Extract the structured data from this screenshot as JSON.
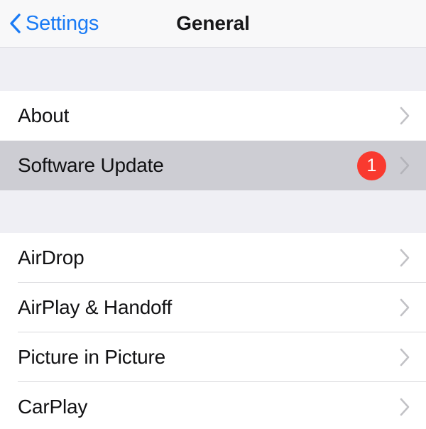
{
  "navbar": {
    "back_label": "Settings",
    "back_icon": "chevron-left-icon",
    "title": "General",
    "accent_color": "#1a7bf5",
    "background_color": "#f8f8f9"
  },
  "colors": {
    "page_background": "#efeff4",
    "row_background": "#ffffff",
    "row_highlighted_background": "#cdcdd3",
    "badge_red": "#f93a2f",
    "separator": "#d8d8dc",
    "chevron_gray": "#c2c2c6",
    "label_text": "#111113"
  },
  "groups": [
    {
      "name": "system-group",
      "rows": [
        {
          "label": "About",
          "highlighted": false,
          "badge": null,
          "accessory_icon": "chevron-right-icon",
          "separator": false
        },
        {
          "label": "Software Update",
          "highlighted": true,
          "badge": "1",
          "accessory_icon": "chevron-right-icon",
          "separator": false
        }
      ]
    },
    {
      "name": "connectivity-group",
      "rows": [
        {
          "label": "AirDrop",
          "highlighted": false,
          "badge": null,
          "accessory_icon": "chevron-right-icon",
          "separator": true
        },
        {
          "label": "AirPlay & Handoff",
          "highlighted": false,
          "badge": null,
          "accessory_icon": "chevron-right-icon",
          "separator": true
        },
        {
          "label": "Picture in Picture",
          "highlighted": false,
          "badge": null,
          "accessory_icon": "chevron-right-icon",
          "separator": true
        },
        {
          "label": "CarPlay",
          "highlighted": false,
          "badge": null,
          "accessory_icon": "chevron-right-icon",
          "separator": false
        }
      ]
    }
  ]
}
